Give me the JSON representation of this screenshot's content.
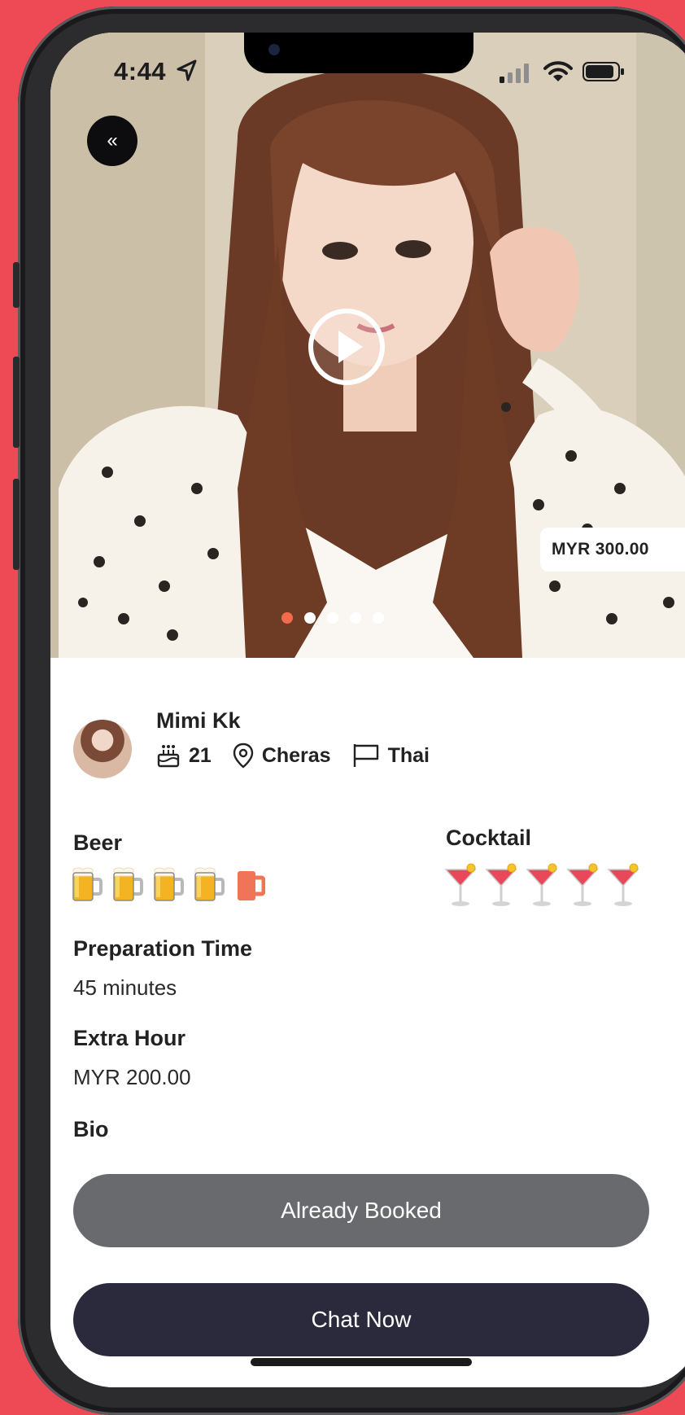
{
  "status_bar": {
    "time": "4:44"
  },
  "hero": {
    "price": "MYR 300.00",
    "slide_count": 5,
    "active_slide": 1
  },
  "profile": {
    "name": "Mimi Kk",
    "age": "21",
    "location": "Cheras",
    "nationality": "Thai"
  },
  "drinks": {
    "beer_label": "Beer",
    "beer_rating": 4,
    "beer_max": 5,
    "cocktail_label": "Cocktail",
    "cocktail_rating": 5,
    "cocktail_max": 5
  },
  "details": {
    "prep_label": "Preparation Time",
    "prep_value": "45 minutes",
    "extra_label": "Extra Hour",
    "extra_value": "MYR 200.00",
    "bio_label": "Bio"
  },
  "actions": {
    "booked_label": "Already Booked",
    "chat_label": "Chat Now"
  },
  "colors": {
    "accent": "#f26b4b",
    "booked_button": "#686a6e",
    "chat_button": "#2b2a3d",
    "background": "#ee4a56"
  }
}
